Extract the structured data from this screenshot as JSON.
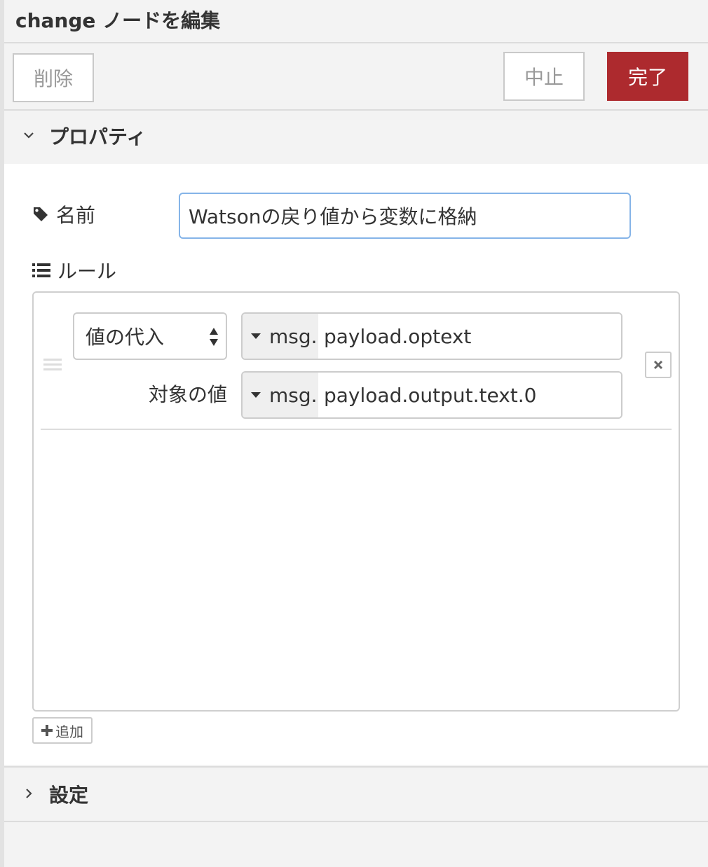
{
  "dialog": {
    "title": "change ノードを編集"
  },
  "toolbar": {
    "delete_label": "削除",
    "cancel_label": "中止",
    "done_label": "完了",
    "done_color": "#ad2a2e"
  },
  "sections": {
    "properties_label": "プロパティ",
    "settings_label": "設定"
  },
  "form": {
    "name_label": "名前",
    "name_value": "Watsonの戻り値から変数に格納",
    "rules_label": "ルール",
    "rules": [
      {
        "action": "値の代入",
        "property_type": "msg.",
        "property_value": "payload.optext",
        "target_label": "対象の値",
        "target_type": "msg.",
        "target_value": "payload.output.text.0"
      }
    ],
    "add_label": "追加"
  },
  "icons": {
    "tag": "tag-icon",
    "list": "list-icon",
    "chevron_down": "chevron-down-icon",
    "chevron_right": "chevron-right-icon",
    "drag": "drag-handle-icon",
    "remove": "close-icon",
    "plus": "plus-icon",
    "caret": "caret-down-icon",
    "select_arrows": "select-arrows-icon"
  },
  "colors": {
    "focus_border": "#85b4e8",
    "background": "#f3f3f3"
  }
}
